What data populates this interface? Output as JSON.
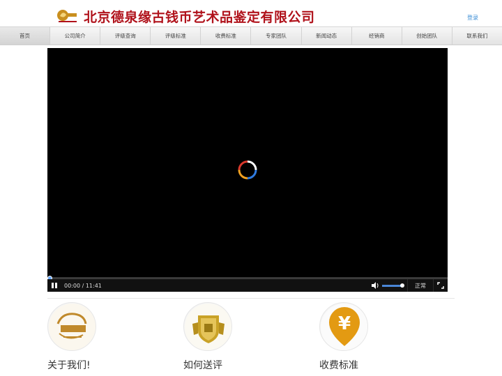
{
  "header": {
    "title": "北京德泉缘古钱币艺术品鉴定有限公司",
    "login": "登录"
  },
  "nav": {
    "items": [
      {
        "label": "首页",
        "name": "nav-home"
      },
      {
        "label": "公司简介",
        "name": "nav-company"
      },
      {
        "label": "评级查询",
        "name": "nav-grading-query"
      },
      {
        "label": "评级标准",
        "name": "nav-grading-standard"
      },
      {
        "label": "收费标准",
        "name": "nav-fees"
      },
      {
        "label": "专家团队",
        "name": "nav-experts"
      },
      {
        "label": "新闻动态",
        "name": "nav-news"
      },
      {
        "label": "经销商",
        "name": "nav-dealers"
      },
      {
        "label": "创始团队",
        "name": "nav-founders"
      },
      {
        "label": "联系我们",
        "name": "nav-contact"
      }
    ],
    "active_index": 0
  },
  "video": {
    "time": "00:00 / 11:41",
    "speed": "正常",
    "progress": 0,
    "volume": 0.85
  },
  "features": [
    {
      "title": "关于我们!",
      "icon": "dragon-logo-icon"
    },
    {
      "title": "如何送评",
      "icon": "gold-shield-icon"
    },
    {
      "title": "收费标准",
      "icon": "yen-pin-icon"
    }
  ],
  "colors": {
    "brand_red": "#b0121b",
    "link_blue": "#3b8ed6",
    "gold": "#e39a12"
  }
}
